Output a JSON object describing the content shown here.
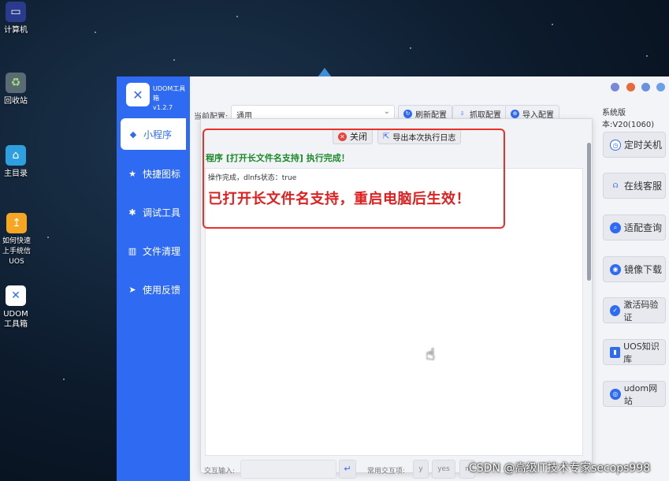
{
  "desktop": {
    "icons": [
      {
        "label": "计算机",
        "icon": "computer-icon"
      },
      {
        "label": "回收站",
        "icon": "trash-icon"
      },
      {
        "label": "主目录",
        "icon": "folder-icon"
      },
      {
        "label": "如何快速上手统信UOS",
        "icon": "uos-help-icon"
      },
      {
        "label": "UDOM工具箱",
        "icon": "udom-icon"
      }
    ]
  },
  "app": {
    "name": "UDOM工具箱",
    "version": "v1.2.7",
    "system_version": "系统版本:V20(1060)"
  },
  "sidebar": {
    "items": [
      {
        "label": "小程序",
        "icon": "cube-icon",
        "active": true
      },
      {
        "label": "快捷图标",
        "icon": "star-icon"
      },
      {
        "label": "调试工具",
        "icon": "bug-icon"
      },
      {
        "label": "文件清理",
        "icon": "trash-icon"
      },
      {
        "label": "使用反馈",
        "icon": "send-icon"
      }
    ]
  },
  "toolbar": {
    "config_label": "当前配置:",
    "config_value": "通用",
    "refresh_label": "刷新配置",
    "fetch_label": "抓取配置",
    "import_label": "导入配置"
  },
  "right_panel": {
    "items": [
      {
        "label": "定时关机",
        "icon": "clock-icon"
      },
      {
        "label": "在线客服",
        "icon": "headset-icon"
      },
      {
        "label": "适配查询",
        "icon": "search-icon"
      },
      {
        "label": "镜像下载",
        "icon": "disc-icon"
      },
      {
        "label": "激活码验证",
        "icon": "check-icon"
      },
      {
        "label": "UOS知识库",
        "icon": "book-icon"
      },
      {
        "label": "udom网站",
        "icon": "globe-icon"
      }
    ]
  },
  "dialog": {
    "close_label": "关闭",
    "export_label": "导出本次执行日志",
    "title": "程序 [打开长文件名支持] 执行完成！",
    "status_line": "操作完成，dlnfs状态：true",
    "message": "已打开长文件名支持，重启电脑后生效！"
  },
  "bottom": {
    "input_label": "交互输入:",
    "common_label": "常用交互项:",
    "chips": [
      "y",
      "yes",
      "n"
    ]
  },
  "watermark": "CSDN @高级IT技术专家secops998",
  "colors": {
    "sidebar": "#2f6bf2",
    "highlight": "#e8312b",
    "success": "#1c8a2a",
    "message": "#e02020"
  }
}
